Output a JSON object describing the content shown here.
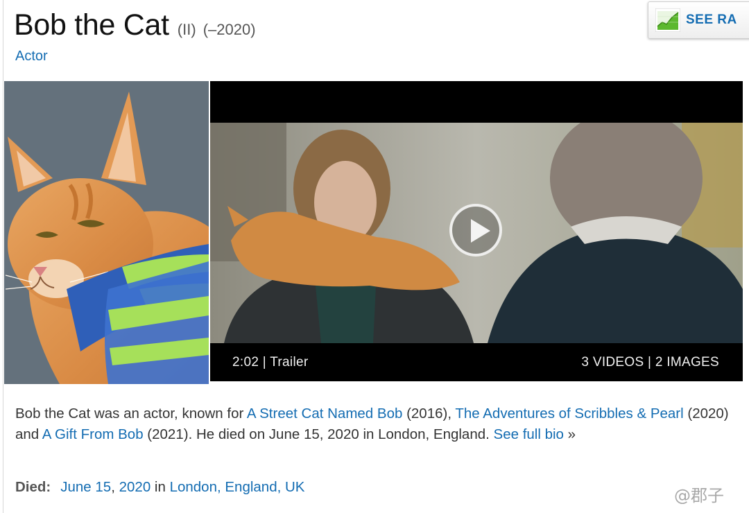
{
  "person": {
    "name": "Bob the Cat",
    "disambiguation": "(II)",
    "years": "(–2020)",
    "role": "Actor"
  },
  "rank_button": {
    "label": "SEE RA",
    "icon": "rising-chart-icon"
  },
  "video": {
    "duration_label": "2:02 | Trailer",
    "media_counts": "3 VIDEOS | 2 IMAGES",
    "play_icon": "play-icon"
  },
  "bio": {
    "intro": "Bob the Cat was an actor, known for ",
    "film1": "A Street Cat Named Bob",
    "film1_year": " (2016), ",
    "film2": "The Adventures of Scribbles & Pearl",
    "film2_year": " (2020) and ",
    "film3": "A Gift From Bob",
    "film3_year": " (2021). He died on June 15, 2020 in London, England. ",
    "see_full_bio": "See full bio",
    "more_arrow": " »"
  },
  "death": {
    "label": "Died:",
    "date_md": "June 15",
    "comma": ", ",
    "year": "2020",
    "in": " in ",
    "place": "London, England, UK"
  },
  "watermark": "@郡子",
  "colors": {
    "link": "#136cb2",
    "rank_green": "#5cb82e"
  }
}
